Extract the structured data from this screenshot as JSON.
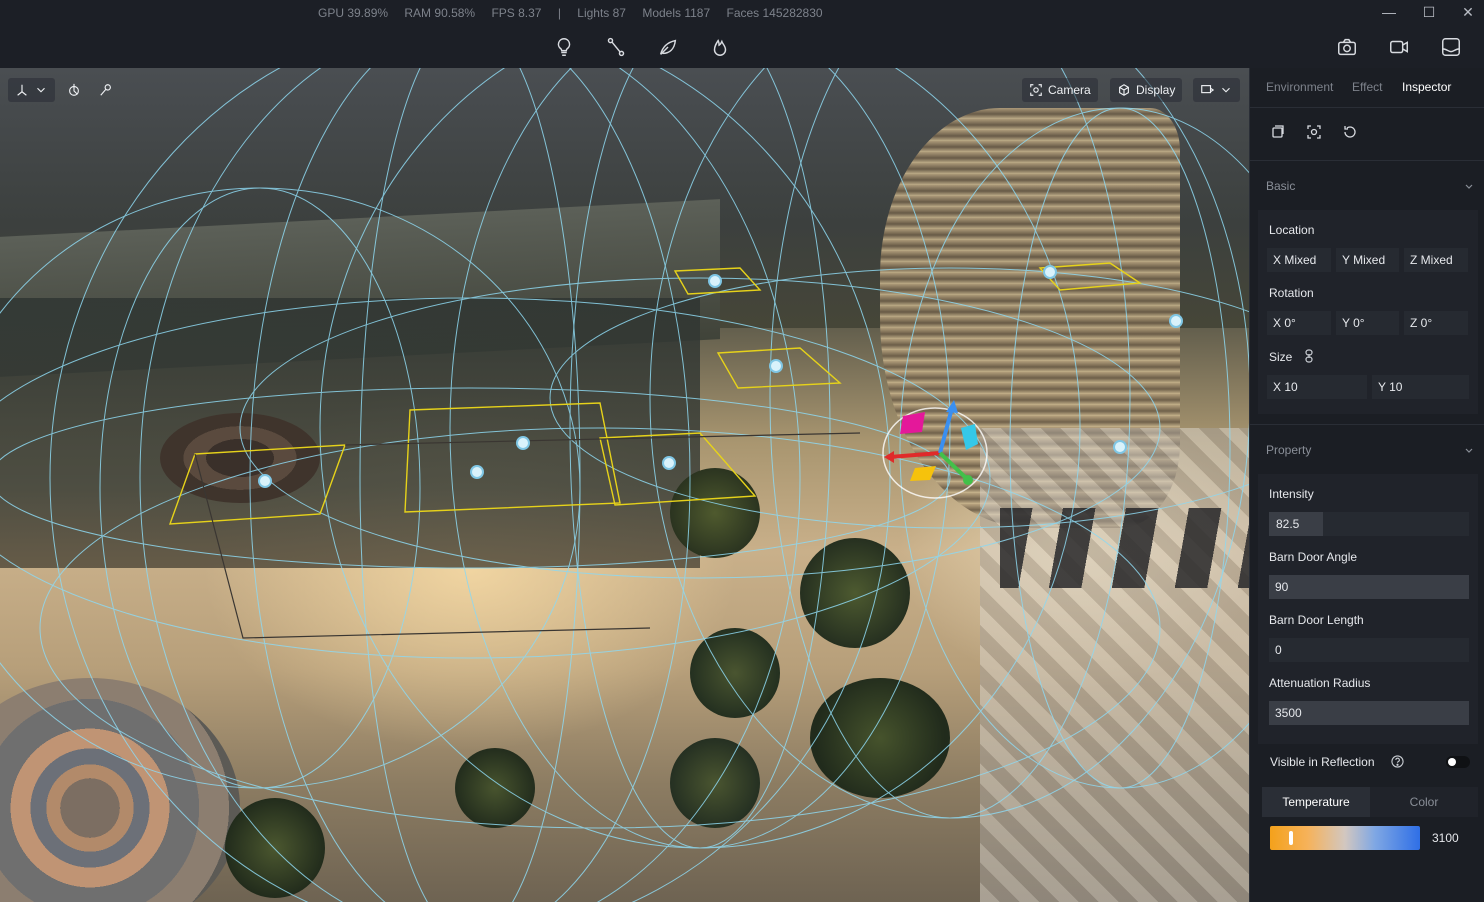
{
  "stats": {
    "gpu": "GPU 39.89%",
    "ram": "RAM 90.58%",
    "fps": "FPS 8.37",
    "divider": "|",
    "lights": "Lights 87",
    "models": "Models 1187",
    "faces": "Faces 145282830"
  },
  "window_controls": {
    "minimize": "—",
    "maximize": "☐",
    "close": "✕"
  },
  "toolbar": {
    "center_icons": [
      "lightbulb-icon",
      "path-icon",
      "leaf-icon",
      "fire-icon"
    ],
    "right_icons": [
      "camera-snapshot-icon",
      "video-icon",
      "image-export-icon"
    ]
  },
  "viewport": {
    "camera_label": "Camera",
    "display_label": "Display"
  },
  "panel": {
    "tabs": [
      {
        "label": "Environment",
        "active": false
      },
      {
        "label": "Effect",
        "active": false
      },
      {
        "label": "Inspector",
        "active": true
      }
    ],
    "basic": {
      "title": "Basic",
      "location_label": "Location",
      "location": {
        "x": "X Mixed",
        "y": "Y Mixed",
        "z": "Z Mixed"
      },
      "rotation_label": "Rotation",
      "rotation": {
        "x": "X 0°",
        "y": "Y 0°",
        "z": "Z 0°"
      },
      "size_label": "Size",
      "size": {
        "x": "X 10",
        "y": "Y 10"
      }
    },
    "property": {
      "title": "Property",
      "intensity_label": "Intensity",
      "intensity_value": "82.5",
      "intensity_fraction": 0.27,
      "barn_door_angle_label": "Barn Door Angle",
      "barn_door_angle_value": "90",
      "barn_door_length_label": "Barn Door Length",
      "barn_door_length_value": "0",
      "attenuation_radius_label": "Attenuation Radius",
      "attenuation_radius_value": "3500",
      "visible_in_reflection_label": "Visible in Reflection",
      "visible_in_reflection": true,
      "temperature_tab": "Temperature",
      "color_tab": "Color",
      "temperature_value": "3100"
    }
  },
  "colors": {
    "accent_toggle": "#ffffff",
    "gizmo_x": "#e02a2a",
    "gizmo_y": "#3a8ff0",
    "gizmo_z": "#43c04a",
    "wireframe": "#8ed8f0",
    "light_rect": "#e6d21a"
  }
}
